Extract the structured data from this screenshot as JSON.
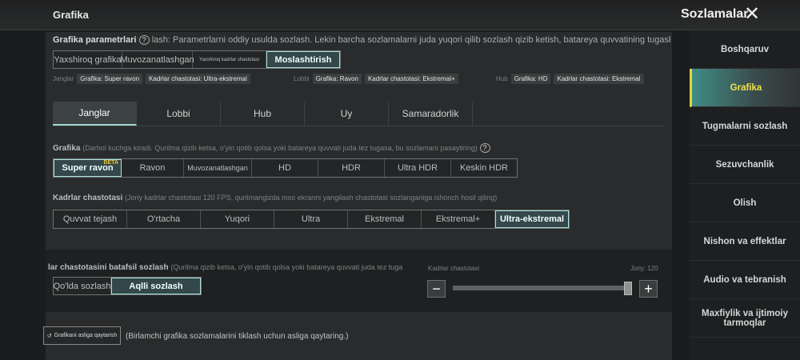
{
  "header": {
    "title": "Grafika",
    "settings_title": "Sozlamalar",
    "close_icon": "close-icon"
  },
  "params": {
    "label": "Grafika parametrlari",
    "desc": "lash: Parametrlarni oddiy usulda sozlash. Lekin barcha sozlamalarni juda yuqori qilib sozlash qizib ketish, batareya quvvatining tugashi yoki beqaror geyn",
    "presets": [
      "Yaxshiroq grafika",
      "Muvozanatlashgan",
      "Yaxshiroq kadrlar chastotasi",
      "Moslashtirish"
    ],
    "selected": 3,
    "summary": [
      {
        "mode": "Janglar",
        "graphics": "Grafika: Super ravon",
        "fps": "Kadrlar chastotasi: Ultra-ekstremal"
      },
      {
        "mode": "Lobbi",
        "graphics": "Grafika: Ravon",
        "fps": "Kadrlar chastotasi: Ekstremal+"
      },
      {
        "mode": "Hub",
        "graphics": "Grafika: HD",
        "fps": "Kadrlar chastotasi: Ekstremal"
      }
    ]
  },
  "tabs": [
    "Janglar",
    "Lobbi",
    "Hub",
    "Uy",
    "Samaradorlik"
  ],
  "graphics": {
    "label": "Grafika",
    "hint": "(Darhol kuchga kiradi. Qurilma qizib ketsa, o'yin qotib qolsa yoki batareya quvvati juda tez tugasa, bu sozlamani pasaytiring)",
    "options": [
      "Super ravon",
      "Ravon",
      "Muvozanatlashgan",
      "HD",
      "HDR",
      "Ultra HDR",
      "Keskin HDR"
    ],
    "beta": "BETA"
  },
  "fps": {
    "label": "Kadrlar chastotasi",
    "hint": "(Joriy kadrlar chastotasi 120 FPS, qurilmangizda mos ekranni yangilash chastotasi sozlanganiga ishonch hosil qiling)",
    "options": [
      "Quvvat tejash",
      "O'rtacha",
      "Yuqori",
      "Ultra",
      "Ekstremal",
      "Ekstremal+",
      "Ultra-ekstremal"
    ]
  },
  "detail": {
    "label": "lar chastotasini batafsil sozlash",
    "hint": "(Qurilma qizib ketsa, o'yin qotib qolsa yoki batareya quvvati juda tez tuga",
    "modes": [
      "Qo'lda sozlash",
      "Aqlli sozlash"
    ],
    "slider_label": "Kadrlar chastotasi",
    "current": "Joriy: 120",
    "slider_value": 1.0,
    "minus": "−",
    "plus": "+"
  },
  "reset": {
    "button": "Grafikani asliga qaytarish",
    "hint": "(Birlamchi grafika sozlamalarini tiklash uchun asliga qaytaring.)"
  },
  "sidebar": [
    "Boshqaruv",
    "Grafika",
    "Tugmalarni sozlash",
    "Sezuvchanlik",
    "Olish",
    "Nishon va effektlar",
    "Audio va tebranish",
    "Maxfiylik va ijtimoiy tarmoqlar"
  ]
}
